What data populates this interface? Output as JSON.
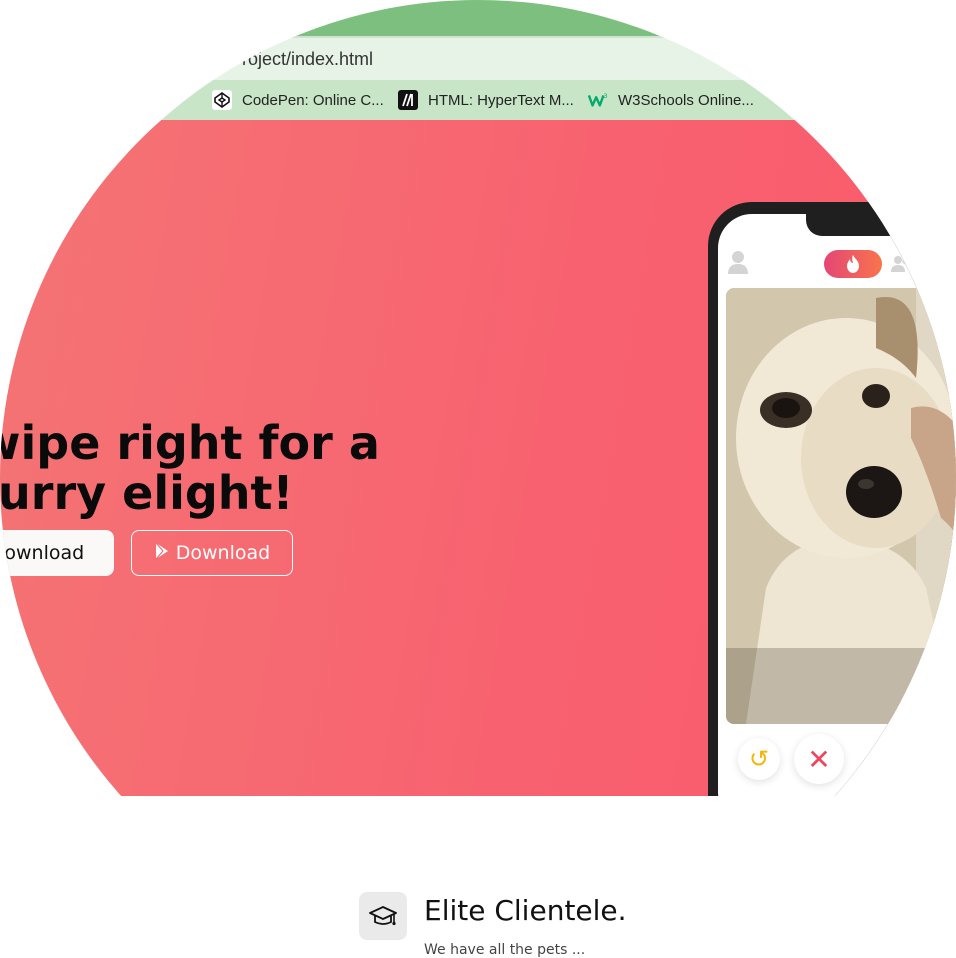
{
  "browser": {
    "url": "roject/index.html",
    "bookmarks": [
      {
        "label": "...",
        "icon": "bookmark-icon"
      },
      {
        "label": "CodePen: Online C...",
        "icon": "codepen-icon"
      },
      {
        "label": "HTML: HyperText M...",
        "icon": "mdn-icon"
      },
      {
        "label": "W3Schools Online...",
        "icon": "w3schools-icon"
      }
    ]
  },
  "hero": {
    "headline": "wipe right for a furry elight!",
    "buttons": {
      "download_light": "Download",
      "download_outline": "Download"
    }
  },
  "phone": {
    "icons": [
      "profile-icon",
      "flame-icon",
      "social-icon",
      "rewind-icon",
      "nope-icon"
    ],
    "rewind_glyph": "↺",
    "nope_glyph": "✕"
  },
  "feature": {
    "title": "Elite Clientele.",
    "subtitle": "We have all the pets ..."
  },
  "colors": {
    "tab_strip": "#7cbf7e",
    "hero_gradient_start": "#f47474",
    "hero_gradient_end": "#fb5a6a",
    "flame_start": "#e44675",
    "flame_end": "#f9744c",
    "nope": "#f0435e",
    "rewind": "#f2b705"
  }
}
